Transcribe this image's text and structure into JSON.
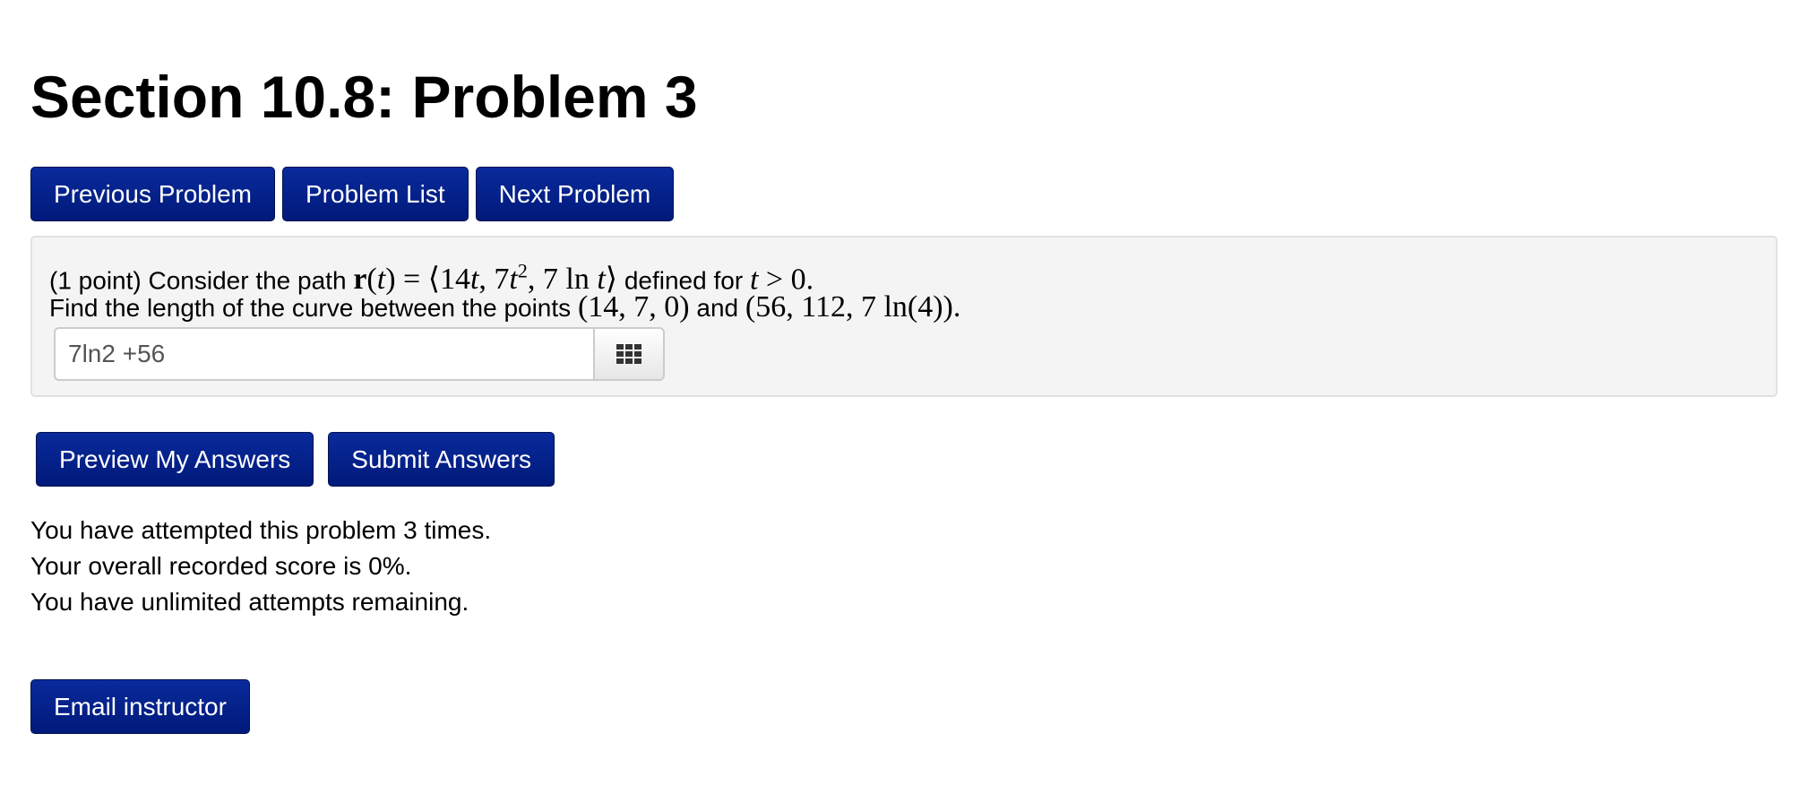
{
  "page": {
    "title": "Section 10.8: Problem 3"
  },
  "nav": {
    "previous_label": "Previous Problem",
    "list_label": "Problem List",
    "next_label": "Next Problem"
  },
  "problem": {
    "points_label": "(1 point) Consider the path",
    "defined_for_label": "defined for",
    "find_label": "Find the length of the curve between the points",
    "and_label": "and",
    "math": {
      "r": "r",
      "t": "t",
      "equals": " = ",
      "tuple_open": "⟨14",
      "tuple_mid1": ", 7",
      "exponent": "2",
      "tuple_mid2": ", 7 ln ",
      "tuple_close": "⟩",
      "gt": " > ",
      "zero": "0",
      "period": ".",
      "point_a": "(14, 7, 0)",
      "point_b": "(56, 112, 7 ln(4))",
      "end_period": "."
    },
    "answer_value": "7ln2 +56",
    "keypad_icon": "grid-keypad-icon"
  },
  "actions": {
    "preview_label": "Preview My Answers",
    "submit_label": "Submit Answers"
  },
  "status": {
    "attempts": "You have attempted this problem 3 times.",
    "score": "Your overall recorded score is 0%.",
    "remaining": "You have unlimited attempts remaining."
  },
  "footer": {
    "email_label": "Email instructor"
  },
  "colors": {
    "button_bg": "#002082",
    "panel_bg": "#f4f4f4",
    "panel_border": "#e1e1e1"
  }
}
